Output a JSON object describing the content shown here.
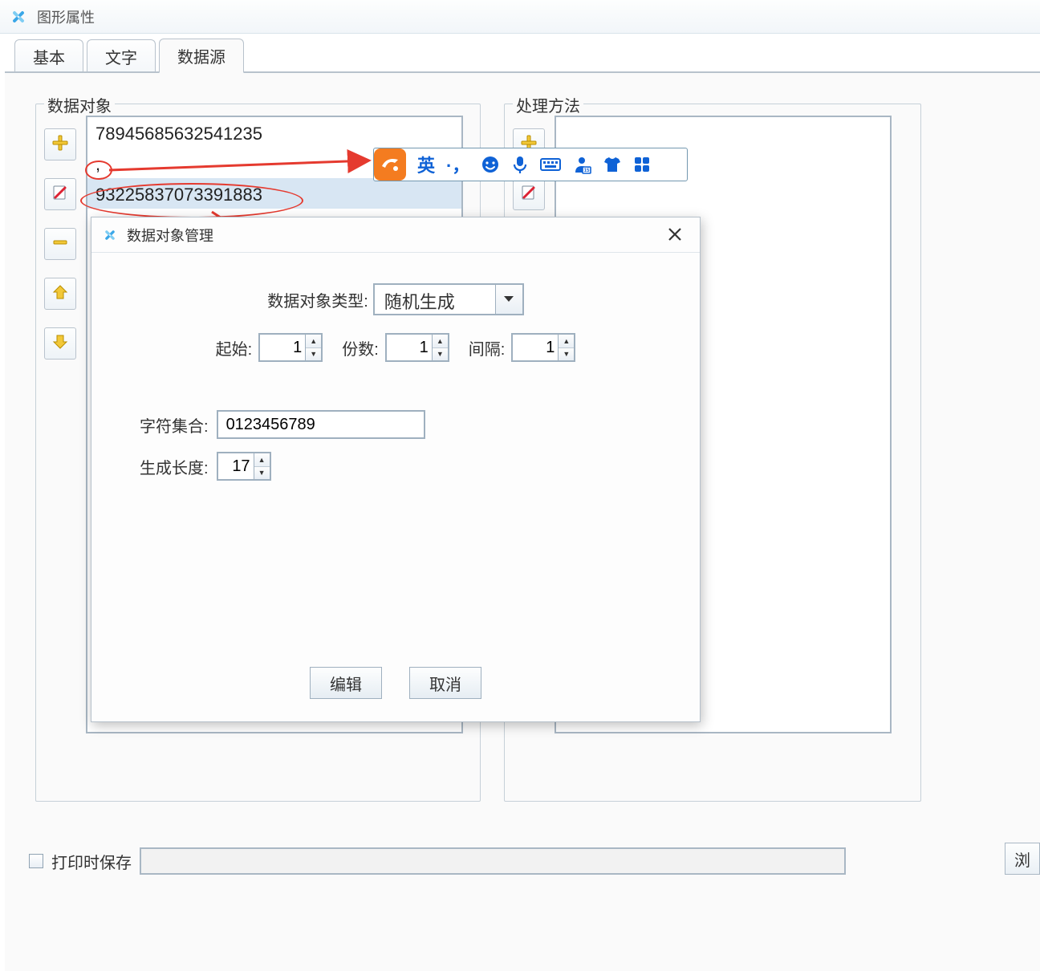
{
  "window": {
    "title": "图形属性"
  },
  "tabs": {
    "basic": "基本",
    "text": "文字",
    "datasource": "数据源"
  },
  "groups": {
    "data_object": "数据对象",
    "process_method": "处理方法"
  },
  "list": {
    "line1": "78945685632541235",
    "line2": ",",
    "line3": "93225837073391883"
  },
  "ime": {
    "lang": "英",
    "punc": "·，"
  },
  "footer": {
    "save_on_print": "打印时保存",
    "browse": "浏"
  },
  "dialog": {
    "title": "数据对象管理",
    "type_label": "数据对象类型:",
    "type_value": "随机生成",
    "start_label": "起始:",
    "start_value": "1",
    "copies_label": "份数:",
    "copies_value": "1",
    "interval_label": "间隔:",
    "interval_value": "1",
    "charset_label": "字符集合:",
    "charset_value": "0123456789",
    "length_label": "生成长度:",
    "length_value": "17",
    "edit_btn": "编辑",
    "cancel_btn": "取消"
  },
  "icons": {
    "add": "plus-icon",
    "edit": "pencil-icon",
    "remove": "minus-icon",
    "up": "arrow-up-icon",
    "down": "arrow-down-icon",
    "edit2": "pencil-doc-icon"
  }
}
